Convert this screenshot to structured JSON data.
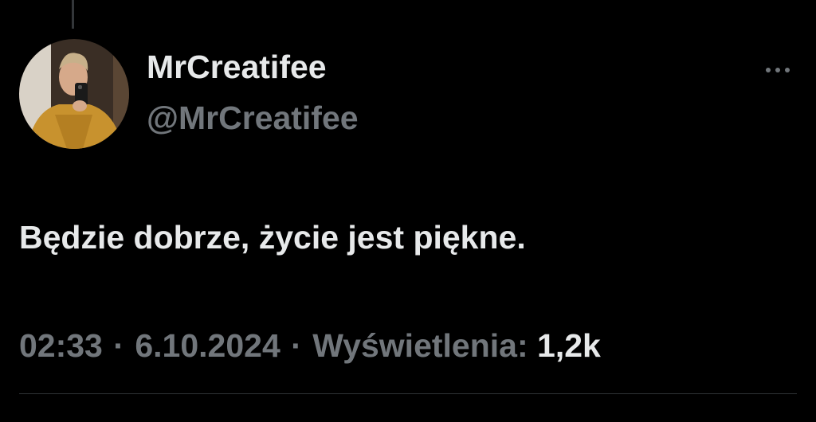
{
  "tweet": {
    "display_name": "MrCreatifee",
    "handle": "@MrCreatifee",
    "text": "Będzie dobrze, życie jest piękne.",
    "time": "02:33",
    "separator": "·",
    "date": "6.10.2024",
    "views_label": "Wyświetlenia:",
    "views_count": "1,2k"
  },
  "icons": {
    "more": "more-horizontal-icon",
    "avatar": "profile-photo"
  },
  "colors": {
    "background": "#000000",
    "primary_text": "#e7e9ea",
    "secondary_text": "#71767b",
    "divider": "#2f3336"
  }
}
